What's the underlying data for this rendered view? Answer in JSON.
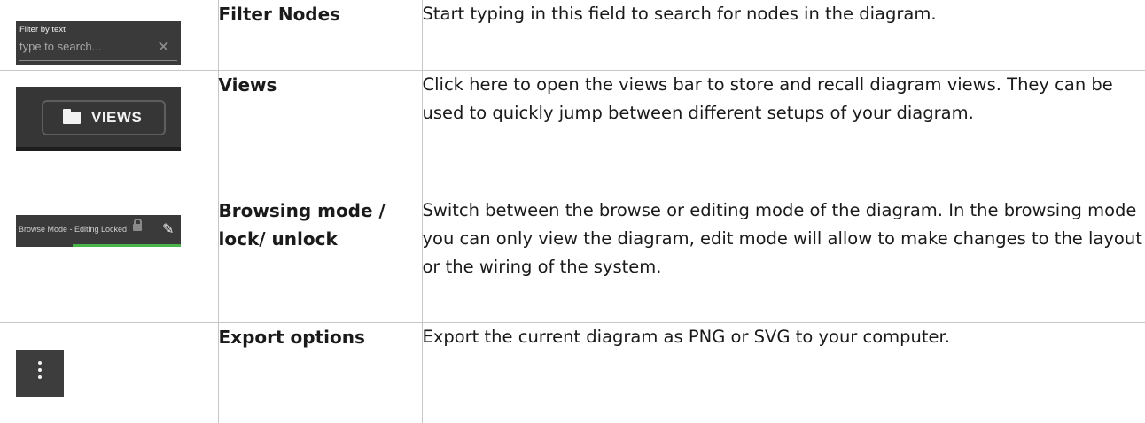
{
  "rows": [
    {
      "term": "Filter Nodes",
      "description": "Start typing in this field to search for nodes in the diagram.",
      "thumbnail": {
        "label": "Filter by text",
        "placeholder": "type to search...",
        "clear_icon": "close-icon"
      }
    },
    {
      "term": "Views",
      "description": "Click here to open the views bar to store and recall diagram views. They can be used to quickly jump between different setups of your diagram.",
      "thumbnail": {
        "button_label": "VIEWS",
        "icon": "folder-icon"
      }
    },
    {
      "term": "Browsing mode / lock/ unlock",
      "description": "Switch between the browse or editing mode of the diagram. In the browsing mode you can only view the diagram, edit mode will allow to make changes to the layout or the wiring of the system.",
      "thumbnail": {
        "status_text": "Browse Mode - Editing Locked",
        "icons": [
          "lock-icon",
          "pencil-icon"
        ],
        "accent": "#47b54a"
      }
    },
    {
      "term": "Export options",
      "description": "Export the current diagram as PNG or SVG to your computer.",
      "thumbnail": {
        "icon": "more-vertical-icon"
      }
    }
  ]
}
